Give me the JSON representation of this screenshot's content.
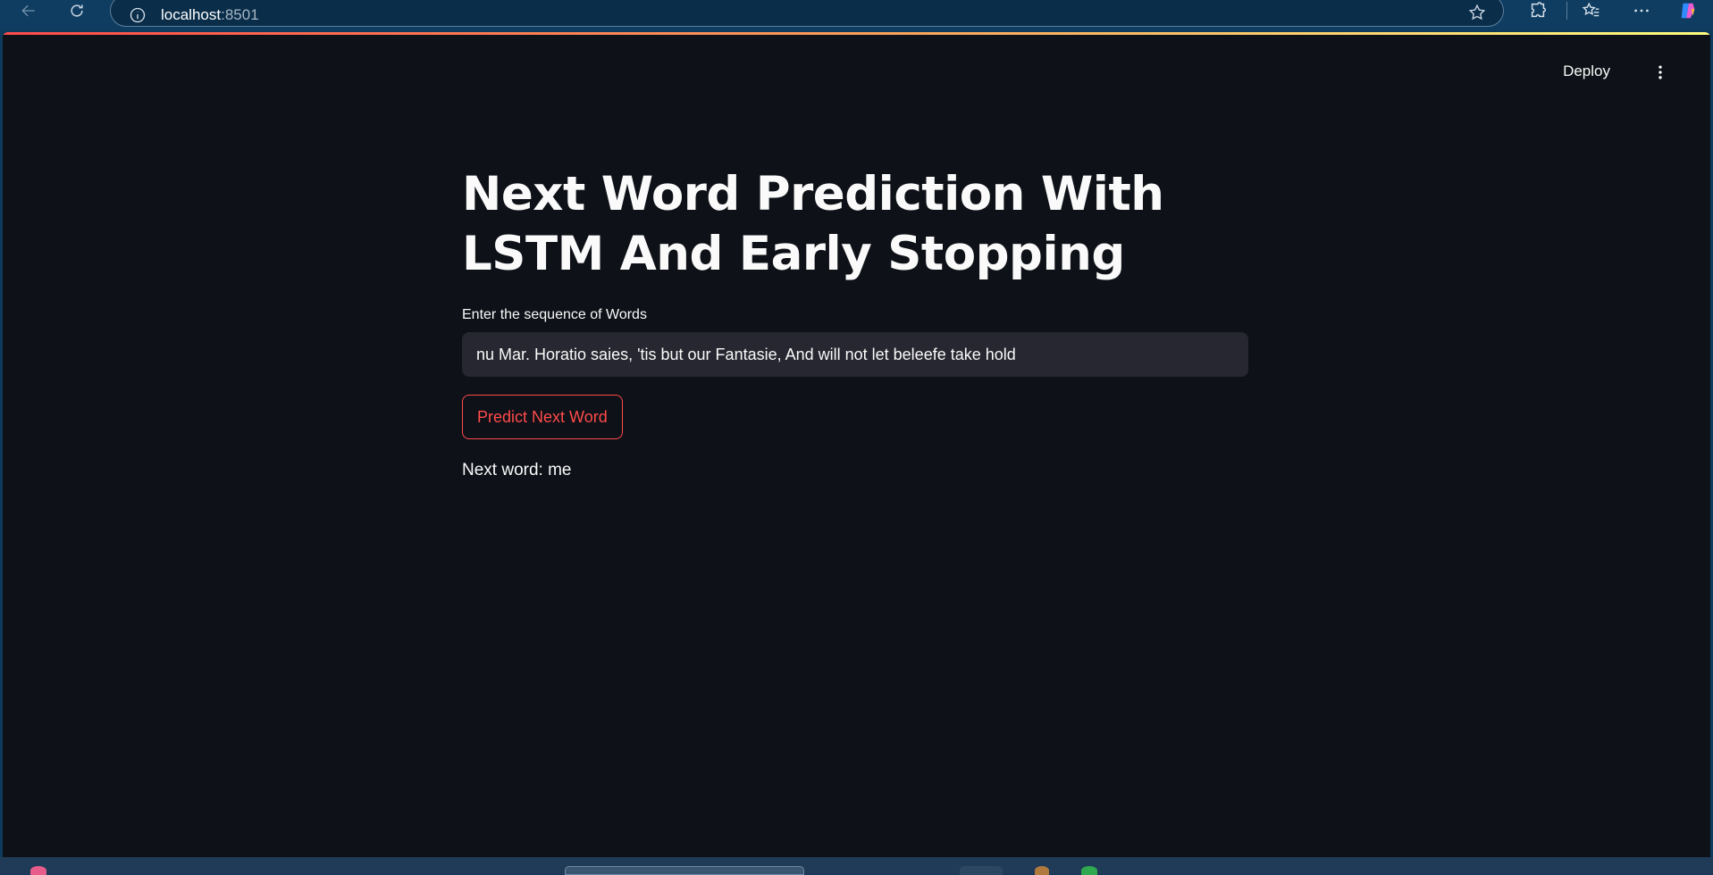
{
  "browser": {
    "url_host": "localhost",
    "url_port": ":8501"
  },
  "header": {
    "deploy_label": "Deploy"
  },
  "main": {
    "title": "Next Word Prediction With LSTM And Early Stopping",
    "input_label": "Enter the sequence of Words",
    "input_value": "nu Mar. Horatio saies, 'tis but our Fantasie, And will not let beleefe take hold",
    "button_label": "Predict Next Word",
    "result": "Next word: me"
  },
  "colors": {
    "accent": "#ff4b4b",
    "background": "#0e1117",
    "input_bg": "#262730",
    "browser_chrome": "#0f3d61"
  },
  "icons": {
    "back": "arrow-left-icon",
    "reload": "reload-icon",
    "info": "info-icon",
    "favorite": "star-icon",
    "extensions": "puzzle-icon",
    "favorites": "favorites-icon",
    "more": "more-horizontal-icon",
    "copilot": "copilot-icon",
    "app_menu": "more-vertical-icon"
  }
}
